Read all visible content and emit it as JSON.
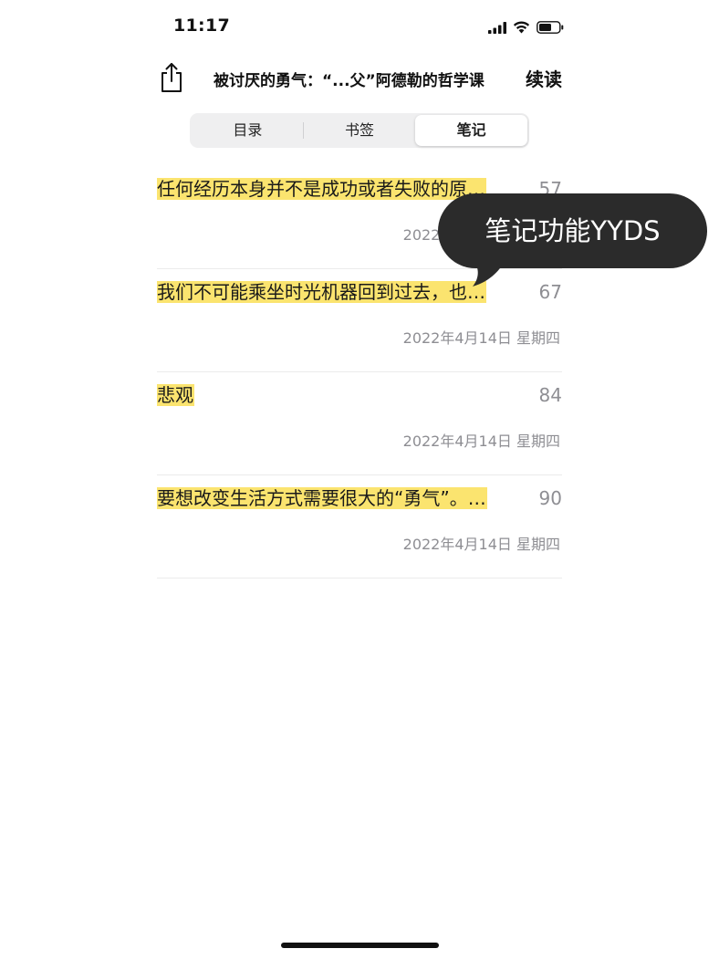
{
  "status_bar": {
    "time": "11:17",
    "icons": [
      "cellular-signal-icon",
      "wifi-icon",
      "battery-icon"
    ]
  },
  "header": {
    "share_icon": "share-icon",
    "title": "被讨厌的勇气：“...父”阿德勒的哲学课",
    "continue_label": "续读"
  },
  "tabs": [
    {
      "label": "目录",
      "active": false
    },
    {
      "label": "书签",
      "active": false
    },
    {
      "label": "笔记",
      "active": true
    }
  ],
  "notes": [
    {
      "text": "任何经历本身并不是成功或者失败的原…",
      "page": "57",
      "date": "2022年4月14日 星期四"
    },
    {
      "text": "我们不可能乘坐时光机器回到过去，也…",
      "page": "67",
      "date": "2022年4月14日 星期四"
    },
    {
      "text": "悲观",
      "page": "84",
      "date": "2022年4月14日 星期四"
    },
    {
      "text": "要想改变生活方式需要很大的“勇气”。…",
      "page": "90",
      "date": "2022年4月14日 星期四"
    }
  ],
  "callout": {
    "text": "笔记功能YYDS"
  },
  "colors": {
    "highlight": "#fbe46f",
    "muted": "#8e8e93",
    "callout_bg": "#2b2b2b"
  }
}
